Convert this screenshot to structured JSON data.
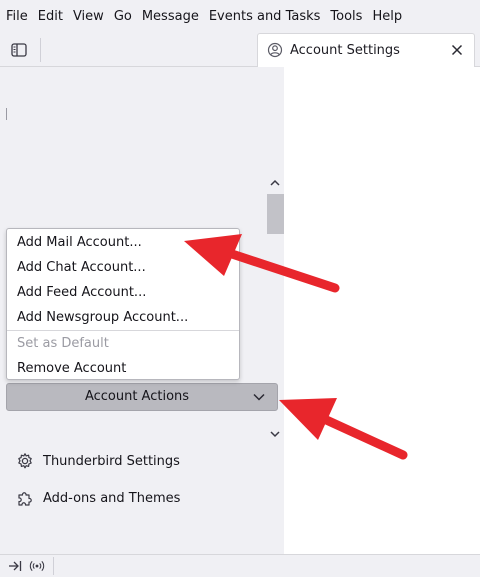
{
  "menubar": {
    "items": [
      {
        "label": "File"
      },
      {
        "label": "Edit"
      },
      {
        "label": "View"
      },
      {
        "label": "Go"
      },
      {
        "label": "Message"
      },
      {
        "label": "Events and Tasks"
      },
      {
        "label": "Tools"
      },
      {
        "label": "Help"
      }
    ]
  },
  "tabbar": {
    "spaces_toggle_icon": "sidebar-panel-icon",
    "tabs": [
      {
        "label": "Account Settings",
        "icon": "gear-circle-icon",
        "close_icon": "close-icon"
      }
    ]
  },
  "sidebar": {
    "account_actions_menu": {
      "items": [
        {
          "label": "Add Mail Account...",
          "enabled": true
        },
        {
          "label": "Add Chat Account...",
          "enabled": true
        },
        {
          "label": "Add Feed Account...",
          "enabled": true
        },
        {
          "label": "Add Newsgroup Account...",
          "enabled": true
        },
        {
          "label": "Set as Default",
          "enabled": false
        },
        {
          "label": "Remove Account",
          "enabled": true
        }
      ]
    },
    "account_actions_button": {
      "label": "Account Actions",
      "icon": "chevron-down-icon"
    },
    "bottom_items": [
      {
        "label": "Thunderbird Settings",
        "icon": "gear-icon"
      },
      {
        "label": "Add-ons and Themes",
        "icon": "puzzle-icon"
      }
    ]
  },
  "statusbar": {
    "icons": [
      "collapse-sidebar-icon",
      "online-status-icon"
    ]
  },
  "colors": {
    "chrome_bg": "#f0f0f4",
    "button_bg": "#b9b9bf",
    "annotation_arrow": "#e8262c"
  }
}
